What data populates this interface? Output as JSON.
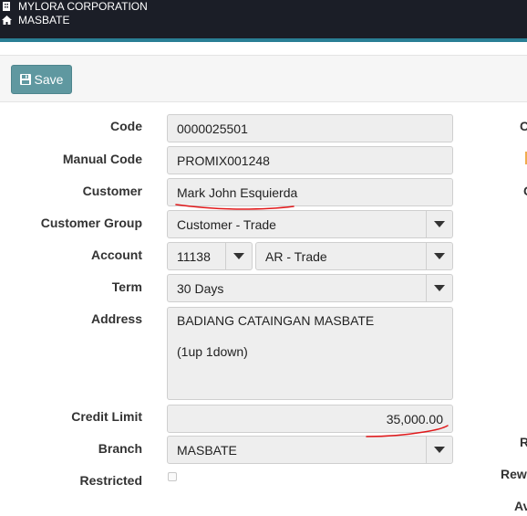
{
  "header": {
    "company": "MYLORA CORPORATION",
    "branch": "MASBATE",
    "company_icon": "building-icon",
    "branch_icon": "home-icon"
  },
  "toolbar": {
    "save_label": "Save",
    "save_icon": "floppy-disk-icon"
  },
  "form": {
    "code": {
      "label": "Code",
      "value": "0000025501"
    },
    "manual_code": {
      "label": "Manual Code",
      "value": "PROMIX001248"
    },
    "customer": {
      "label": "Customer",
      "value": "Mark John Esquierda"
    },
    "customer_group": {
      "label": "Customer Group",
      "value": "Customer - Trade"
    },
    "account": {
      "label": "Account",
      "number": "11138",
      "name": "AR - Trade"
    },
    "term": {
      "label": "Term",
      "value": "30 Days"
    },
    "address": {
      "label": "Address",
      "line1": "BADIANG CATAINGAN MASBATE",
      "line2": "(1up 1down)"
    },
    "credit_limit": {
      "label": "Credit Limit",
      "value": "35,000.00"
    },
    "branch": {
      "label": "Branch",
      "value": "MASBATE"
    },
    "restricted": {
      "label": "Restricted",
      "checked": false
    }
  },
  "right_column_clipped": {
    "item1": "C",
    "item2": "C",
    "item3": "R",
    "item4": "Rewa",
    "item5": "Av"
  },
  "colors": {
    "header_bg": "#1b1e27",
    "header_accent": "#2a7f95",
    "save_button": "#5f98a0",
    "annotation": "#e0191b"
  }
}
